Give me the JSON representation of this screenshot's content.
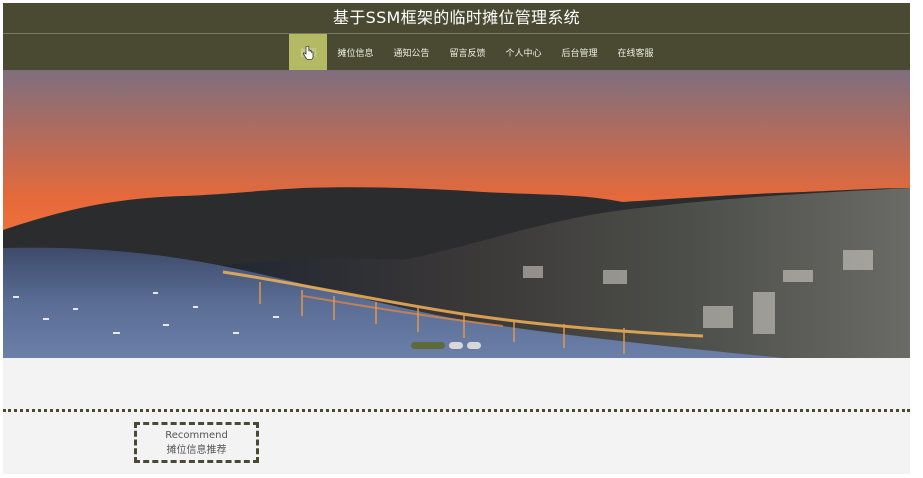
{
  "header": {
    "title": "基于SSM框架的临时摊位管理系统"
  },
  "nav": {
    "items": [
      {
        "label": "首页",
        "active": true
      },
      {
        "label": "摊位信息",
        "active": false
      },
      {
        "label": "通知公告",
        "active": false
      },
      {
        "label": "留言反馈",
        "active": false
      },
      {
        "label": "个人中心",
        "active": false
      },
      {
        "label": "后台管理",
        "active": false
      },
      {
        "label": "在线客服",
        "active": false
      }
    ]
  },
  "carousel": {
    "slide_count": 3,
    "active_index": 0
  },
  "section": {
    "recommend_en": "Recommend",
    "recommend_cn": "摊位信息推荐"
  },
  "colors": {
    "header_bg": "#4a4a33",
    "nav_active_bg": "#b4ba63",
    "section_bg": "#f3f3f3",
    "dot_active": "#5e6a3a"
  }
}
